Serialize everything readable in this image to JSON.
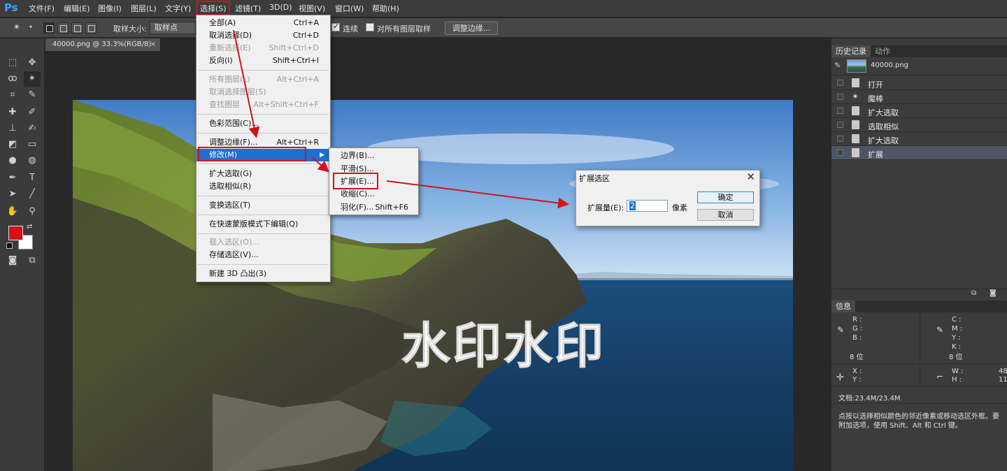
{
  "app": {
    "logo": "Ps"
  },
  "menubar": [
    "文件(F)",
    "编辑(E)",
    "图像(I)",
    "图层(L)",
    "文字(Y)",
    "选择(S)",
    "滤镜(T)",
    "3D(D)",
    "视图(V)",
    "窗口(W)",
    "帮助(H)"
  ],
  "options_bar": {
    "sample_size_label": "取样大小:",
    "sample_size_value": "取样点",
    "contiguous_label": "连续",
    "sample_all_label": "对所有图层取样",
    "refine_edge_button": "调整边缘..."
  },
  "document": {
    "tab_title": "40000.png @ 33.3%(RGB/8)",
    "close_glyph": "×",
    "watermark_text": "水印水印"
  },
  "select_menu": {
    "items": [
      {
        "label": "全部(A)",
        "shortcut": "Ctrl+A",
        "disabled": false
      },
      {
        "label": "取消选择(D)",
        "shortcut": "Ctrl+D",
        "disabled": false
      },
      {
        "label": "重新选择(E)",
        "shortcut": "Shift+Ctrl+D",
        "disabled": true
      },
      {
        "label": "反向(I)",
        "shortcut": "Shift+Ctrl+I",
        "disabled": false
      },
      {
        "label": "所有图层(L)",
        "shortcut": "Alt+Ctrl+A",
        "disabled": true
      },
      {
        "label": "取消选择图层(S)",
        "shortcut": "",
        "disabled": true
      },
      {
        "label": "查找图层",
        "shortcut": "Alt+Shift+Ctrl+F",
        "disabled": true
      },
      {
        "label": "色彩范围(C)...",
        "shortcut": "",
        "disabled": false
      },
      {
        "label": "调整边缘(F)...",
        "shortcut": "Alt+Ctrl+R",
        "disabled": false
      },
      {
        "label": "修改(M)",
        "shortcut": "",
        "disabled": false,
        "highlighted": true,
        "submenu": true
      },
      {
        "label": "扩大选取(G)",
        "shortcut": "",
        "disabled": false
      },
      {
        "label": "选取相似(R)",
        "shortcut": "",
        "disabled": false
      },
      {
        "label": "变换选区(T)",
        "shortcut": "",
        "disabled": false
      },
      {
        "label": "在快速蒙版模式下编辑(Q)",
        "shortcut": "",
        "disabled": false
      },
      {
        "label": "载入选区(O)...",
        "shortcut": "",
        "disabled": true
      },
      {
        "label": "存储选区(V)...",
        "shortcut": "",
        "disabled": false
      },
      {
        "label": "新建 3D 凸出(3)",
        "shortcut": "",
        "disabled": false
      }
    ]
  },
  "modify_submenu": {
    "items": [
      {
        "label": "边界(B)...",
        "shortcut": ""
      },
      {
        "label": "平滑(S)...",
        "shortcut": ""
      },
      {
        "label": "扩展(E)...",
        "shortcut": ""
      },
      {
        "label": "收缩(C)...",
        "shortcut": ""
      },
      {
        "label": "羽化(F)...",
        "shortcut": "Shift+F6"
      }
    ]
  },
  "expand_dialog": {
    "title": "扩展选区",
    "close_glyph": "✕",
    "amount_label": "扩展量(E):",
    "amount_value": "2",
    "unit": "像素",
    "ok_button": "确定",
    "cancel_button": "取消"
  },
  "history_panel": {
    "tabs": [
      "历史记录",
      "动作"
    ],
    "snapshot_name": "40000.png",
    "states": [
      "打开",
      "魔棒",
      "扩大选取",
      "选取相似",
      "扩大选取",
      "扩展"
    ]
  },
  "info_panel": {
    "tab": "信息",
    "rgb_labels": [
      "R :",
      "G :",
      "B :"
    ],
    "cmyk_labels": [
      "C :",
      "M :",
      "Y :",
      "K :"
    ],
    "bit_depth_left": "8 位",
    "bit_depth_right": "8 位",
    "xy_labels": [
      "X :",
      "Y :"
    ],
    "wh_labels": [
      "W :",
      "H :"
    ],
    "wh_values": [
      "48",
      "11"
    ],
    "doc_size": "文档:23.4M/23.4M",
    "hint_line1": "点按以选择相似颜色的邻近像素或移动选区外框。要",
    "hint_line2": "附加选项，使用 Shift、Alt 和 Ctrl 键。"
  },
  "colors": {
    "foreground": "#d8101c",
    "background": "#ffffff",
    "menu_highlight": "#1e6fd0",
    "annotation_red": "#d0141e"
  }
}
